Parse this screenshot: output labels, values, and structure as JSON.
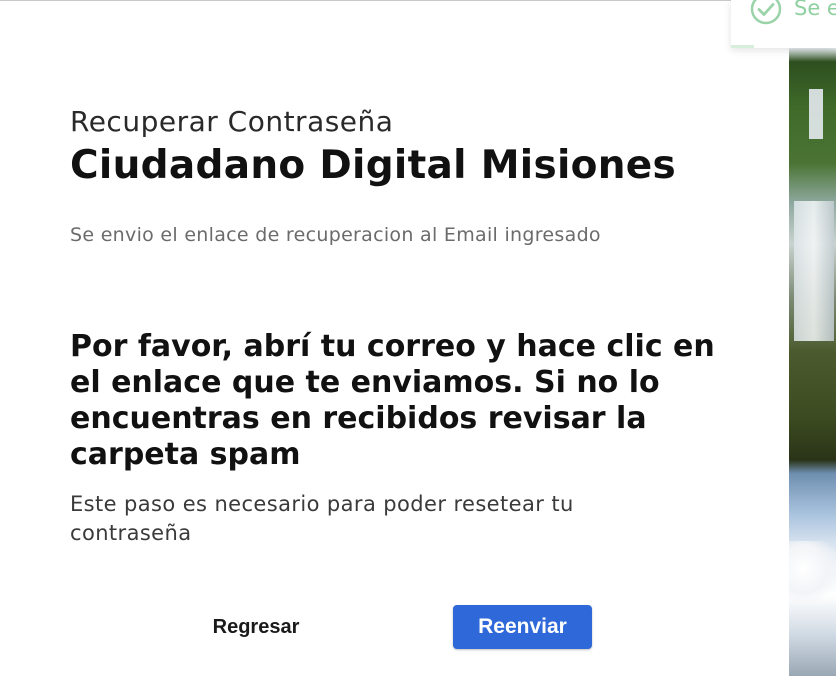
{
  "page": {
    "subtitle": "Recuperar Contraseña",
    "title": "Ciudadano Digital Misiones",
    "info_text": "Se envio el enlace de recuperacion al Email ingresado",
    "instruction": "Por favor, abrí tu correo y hace clic en el enlace que te enviamos. Si no lo encuentras en recibidos revisar la carpeta spam",
    "note": "Este paso es necesario para poder resetear tu contraseña"
  },
  "buttons": {
    "back_label": "Regresar",
    "resend_label": "Reenviar"
  },
  "toast": {
    "icon": "check-circle-icon",
    "text": "Se e",
    "progress": 0.22,
    "color": "#8fd0a0"
  },
  "colors": {
    "primary_button": "#2f68d8"
  }
}
